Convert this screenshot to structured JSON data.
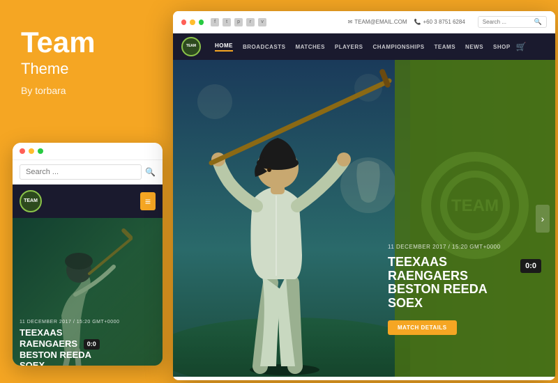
{
  "left": {
    "title": "Team",
    "subtitle": "Theme",
    "author": "By torbara"
  },
  "mobile": {
    "dots": [
      "red",
      "yellow",
      "green"
    ],
    "search_placeholder": "Search ...",
    "logo_text": "TEAM",
    "match_date": "11 DECEMBER 2017 / 15:20 GMT+0000",
    "team1": "TEEXAAS",
    "team2": "RAENGAERS",
    "team3": "BESTON REEDA",
    "team4": "SOEX",
    "score": "0:0"
  },
  "desktop": {
    "dots": [
      "red",
      "yellow",
      "green"
    ],
    "email": "TEAM@EMAIL.COM",
    "phone": "+60 3 8751 6284",
    "search_placeholder": "Search ...",
    "logo_text": "TEAM",
    "nav_items": [
      {
        "label": "HOME",
        "active": true
      },
      {
        "label": "BROADCASTS",
        "active": false
      },
      {
        "label": "MATCHES",
        "active": false
      },
      {
        "label": "PLAYERS",
        "active": false
      },
      {
        "label": "CHAMPIONSHIPS",
        "active": false
      },
      {
        "label": "TEAMS",
        "active": false
      },
      {
        "label": "NEWS",
        "active": false
      },
      {
        "label": "SHOP",
        "active": false
      }
    ],
    "hero": {
      "date": "11 DECEMBER 2017 / 15:20 GMT+0000",
      "team1": "TEEXAAS RAENGAERS",
      "team2": "BESTON REEDA SOEX",
      "score": "0:0",
      "cta": "MATCH DETAILS"
    },
    "colors": {
      "orange": "#F5A623",
      "dark_nav": "#1a1a2e",
      "hero_green": "#4a7a20"
    }
  }
}
